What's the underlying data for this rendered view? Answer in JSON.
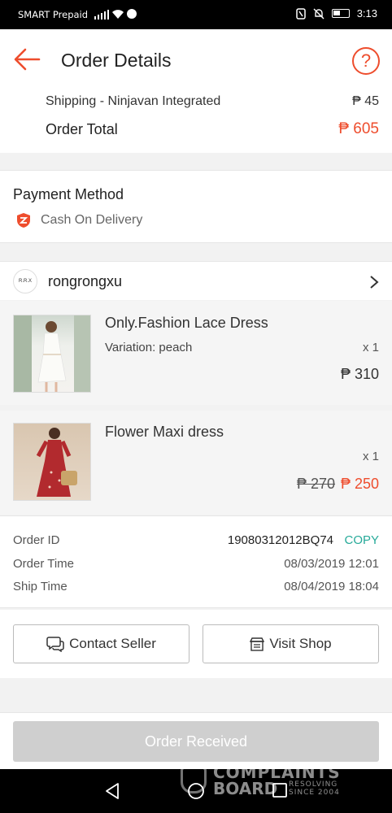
{
  "status_bar": {
    "carrier": "SMART Prepaid",
    "time": "3:13"
  },
  "header": {
    "title": "Order Details"
  },
  "totals": {
    "shipping_label": "Shipping - Ninjavan Integrated",
    "shipping_value": "₱ 45",
    "total_label": "Order Total",
    "total_value": "₱ 605"
  },
  "payment": {
    "heading": "Payment Method",
    "method": "Cash On Delivery"
  },
  "shop": {
    "avatar_text": "R.R.X",
    "name": "rongrongxu"
  },
  "items": [
    {
      "name": "Only.Fashion Lace Dress",
      "variation": "Variation: peach",
      "qty": "x 1",
      "price": "₱ 310"
    },
    {
      "name": "Flower Maxi dress",
      "qty": "x 1",
      "original_price": "₱ 270",
      "sale_price": "₱ 250"
    }
  ],
  "order_info": {
    "id_label": "Order ID",
    "id_value": "19080312012BQ74",
    "copy_label": "COPY",
    "order_time_label": "Order Time",
    "order_time_value": "08/03/2019 12:01",
    "ship_time_label": "Ship Time",
    "ship_time_value": "08/04/2019 18:04"
  },
  "actions": {
    "contact_label": "Contact Seller",
    "visit_label": "Visit Shop"
  },
  "bottom": {
    "received_label": "Order Received"
  },
  "watermark": {
    "line1": "COMPLAINTS",
    "line2": "BOARD",
    "sub1": "RESOLVING",
    "sub2": "SINCE 2004"
  },
  "colors": {
    "accent": "#ee4d2d",
    "copy": "#26aa99",
    "disabled_button": "#cfcfcf"
  },
  "icons": [
    "back-arrow-icon",
    "help-icon",
    "cod-shield-icon",
    "chevron-right-icon",
    "chat-icon",
    "shop-icon",
    "nav-back-icon",
    "nav-home-icon",
    "nav-recents-icon"
  ]
}
